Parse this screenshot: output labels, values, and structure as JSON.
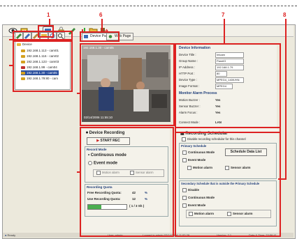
{
  "callouts": [
    "1",
    "2",
    "3",
    "4",
    "5",
    "6",
    "7",
    "8"
  ],
  "tabs": [
    {
      "label": "Device Panel"
    },
    {
      "label": "Web Page"
    }
  ],
  "tree": {
    "root": "Device",
    "items": [
      "192.168.1.113 - cam01",
      "192.168.1.116 - cam02",
      "192.168.1.123 - cam03",
      "192.168.1.99 - cam04",
      "192.168.1.30 - cam05",
      "192.168.1.79:80 - cam"
    ]
  },
  "video": {
    "header": "192.168.1.30 - cam05",
    "timestamp": "02/14/2006 11:55:10"
  },
  "device_info": {
    "title": "Device Information",
    "rows": [
      {
        "label": "Device Title :",
        "value": "Intcam"
      },
      {
        "label": "Group Name :",
        "value": "PanelG"
      },
      {
        "label": "IP Address :",
        "value": "192.168.1.79"
      },
      {
        "label": "HTTP Port :",
        "value": "80"
      },
      {
        "label": "Device Type :",
        "value": "MPEG4_140K/HN"
      },
      {
        "label": "Image Format :",
        "value": "MPEG4"
      }
    ],
    "alarm_title": "Monitor Alarm Process",
    "alarm_rows": [
      {
        "label": "Motion Buzzer :",
        "value": "Yes"
      },
      {
        "label": "Sensor Buzzer :",
        "value": "Yes"
      },
      {
        "label": "Alarm Focus :",
        "value": "Yes"
      },
      {
        "label": "Connect Mode :",
        "value": "LAN"
      }
    ]
  },
  "recording": {
    "title": "Device Recording",
    "start_rec": "START REC",
    "mode_title": "Record Mode",
    "continuous": "Continuous mode",
    "event": "Event mode",
    "motion_alarm": "Motion alarm",
    "sensor_alarm": "Sensor alarm",
    "quota_title": "Recording Quota",
    "free_quota_label": "Free Recording Quota:",
    "free_quota_value": "42",
    "free_quota_unit": "%",
    "use_quota_label": "Use Recording Quota:",
    "use_quota_value": "12",
    "use_quota_unit": "%",
    "progress_text": "( 1 / 3 Sh )",
    "progress_fraction": 0.35
  },
  "schedule": {
    "title": "Recording Schedular",
    "disable_text": "Disable recording schedular for this channel",
    "primary_title": "Primary Schedule",
    "continuous": "Continuous Mode",
    "data_list_btn": "Schedule Data List",
    "event": "Event Mode",
    "motion_alarm": "Motion alarm",
    "sensor_alarm": "Sensor alarm",
    "secondary_title": "Secondary Schedule that is outside the Primary Schedule",
    "disable": "Disable",
    "continuous2": "Continuous Mode",
    "event2": "Event Mode",
    "motion_alarm2": "Motion alarm",
    "sensor_alarm2": "Sensor alarm"
  },
  "status": {
    "left": "Ready",
    "user": "User: admin",
    "login": "Logged in admin 02/14/2006 11:52:29",
    "version": "Version: 2.1",
    "datetime": "Date & Time: 23:56:41"
  }
}
